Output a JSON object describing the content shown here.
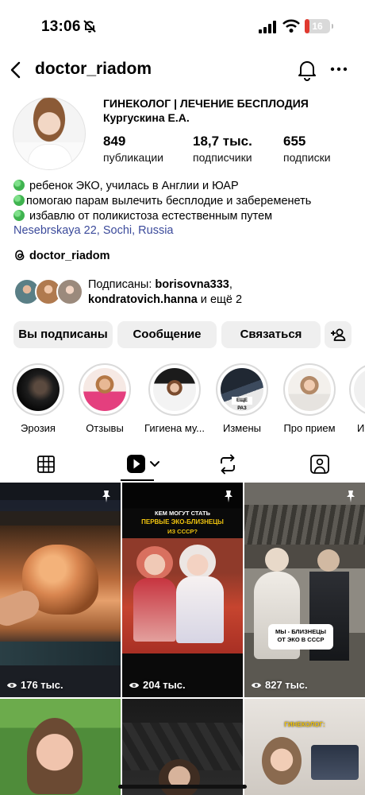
{
  "status_bar": {
    "time": "13:06",
    "battery": "16",
    "battery_level": 0.16
  },
  "header": {
    "username": "doctor_riadom"
  },
  "profile": {
    "name_line1": "ГИНЕКОЛОГ | ЛЕЧЕНИЕ БЕСПЛОДИЯ",
    "name_line2": "Кургускина Е.А.",
    "stats": [
      {
        "value": "849",
        "label": "публикации"
      },
      {
        "value": "18,7 тыс.",
        "label": "подписчики"
      },
      {
        "value": "655",
        "label": "подписки"
      }
    ],
    "bio": [
      "ребенок ЭКО, училась в Англии и ЮАР",
      "помогаю парам вылечить бесплодие и забеременеть",
      "избавлю от поликистоза естественным путем"
    ],
    "location": "Nesebrskaya 22, Sochi, Russia",
    "threads_handle": "doctor_riadom",
    "followed_by": {
      "prefix": "Подписаны: ",
      "user1": "borisovna333",
      "separator": ",",
      "user2": "kondratovich.hanna",
      "suffix": " и ещё 2"
    }
  },
  "actions": {
    "following": "Вы подписаны",
    "message": "Сообщение",
    "contact": "Связаться"
  },
  "highlights": [
    {
      "label": "Эрозия"
    },
    {
      "label": "Отзывы"
    },
    {
      "label": "Гигиена му..."
    },
    {
      "label": "Измены"
    },
    {
      "label": "Про прием"
    },
    {
      "label": "И"
    }
  ],
  "highlight_badge": "ЕЩЕ РАЗ",
  "posts": [
    {
      "views": "176 тыс.",
      "pinned": true
    },
    {
      "views": "204 тыс.",
      "pinned": true,
      "overlay": [
        "КЕМ МОГУТ СТАТЬ",
        "ПЕРВЫЕ ЭКО-БЛИЗНЕЦЫ",
        "ИЗ СССР?"
      ]
    },
    {
      "views": "827 тыс.",
      "pinned": true,
      "overlay": [
        "МЫ - БЛИЗНЕЦЫ",
        "ОТ ЭКО В СССР"
      ]
    },
    {
      "overlay": []
    },
    {
      "overlay": []
    },
    {
      "overlay": [
        "ГИНЕКОЛОГ:"
      ]
    }
  ],
  "colors": {
    "link": "#3b4a9b",
    "button_bg": "#efefef",
    "green_dot": "#3fb34f",
    "battery_low": "#e0392f"
  }
}
